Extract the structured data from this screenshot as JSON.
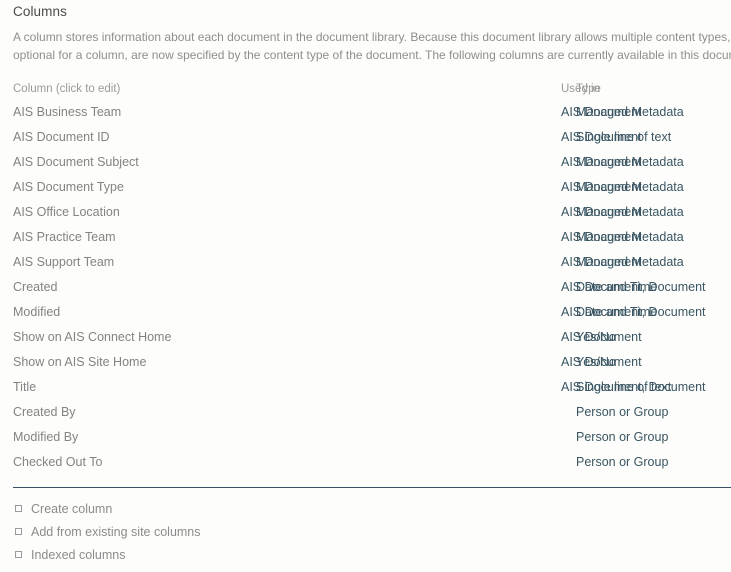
{
  "page": {
    "heading": "Columns",
    "description_line_1": "A column stores information about each document in the document library. Because this document library allows multiple content types, so",
    "description_line_2": "optional for a column, are now specified by the content type of the document. The following columns are currently available in this docume"
  },
  "table": {
    "headers": {
      "name": "Column (click to edit)",
      "type": "Type",
      "used_in": "Used in"
    },
    "rows": [
      {
        "name": "AIS Business Team",
        "type": "Managed Metadata",
        "used_in": "AIS Document"
      },
      {
        "name": "AIS Document ID",
        "type": "Single line of text",
        "used_in": "AIS Document"
      },
      {
        "name": "AIS Document Subject",
        "type": "Managed Metadata",
        "used_in": "AIS Document"
      },
      {
        "name": "AIS Document Type",
        "type": "Managed Metadata",
        "used_in": "AIS Document"
      },
      {
        "name": "AIS Office Location",
        "type": "Managed Metadata",
        "used_in": "AIS Document"
      },
      {
        "name": "AIS Practice Team",
        "type": "Managed Metadata",
        "used_in": "AIS Document"
      },
      {
        "name": "AIS Support Team",
        "type": "Managed Metadata",
        "used_in": "AIS Document"
      },
      {
        "name": "Created",
        "type": "Date and Time",
        "used_in": "AIS Document, Document"
      },
      {
        "name": "Modified",
        "type": "Date and Time",
        "used_in": "AIS Document, Document"
      },
      {
        "name": "Show on AIS Connect Home",
        "type": "Yes/No",
        "used_in": "AIS Document"
      },
      {
        "name": "Show on AIS Site Home",
        "type": "Yes/No",
        "used_in": "AIS Document"
      },
      {
        "name": "Title",
        "type": "Single line of text",
        "used_in": "AIS Document, Document"
      },
      {
        "name": "Created By",
        "type": "Person or Group",
        "used_in": ""
      },
      {
        "name": "Modified By",
        "type": "Person or Group",
        "used_in": ""
      },
      {
        "name": "Checked Out To",
        "type": "Person or Group",
        "used_in": ""
      }
    ]
  },
  "footer": {
    "links": [
      {
        "label": "Create column"
      },
      {
        "label": "Add from existing site columns"
      },
      {
        "label": "Indexed columns"
      }
    ]
  },
  "colors": {
    "link": "#3a5563",
    "muted_text": "#8b8b8b",
    "divider": "#3c5263",
    "background": "#fdfefb"
  }
}
